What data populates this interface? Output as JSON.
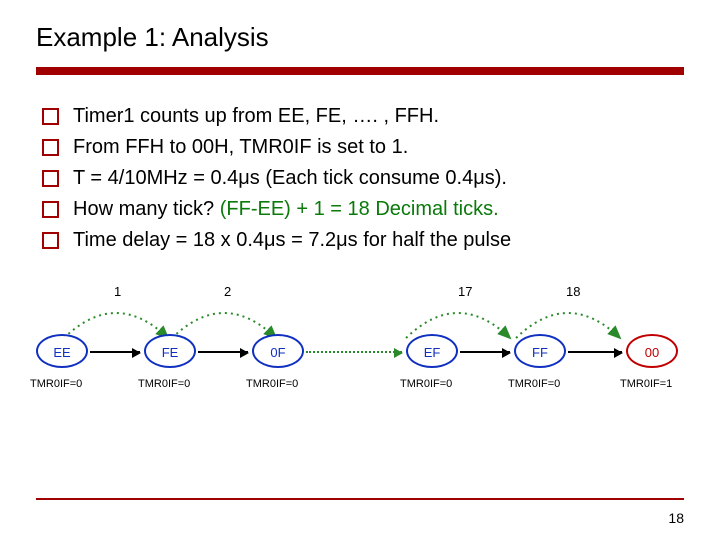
{
  "title": "Example 1: Analysis",
  "bullets": {
    "b0": "Timer1 counts up from EE, FE, …. , FFH.",
    "b1": "From FFH to 00H, TMR0IF is set to 1.",
    "b2": "T = 4/10MHz = 0.4μs (Each tick consume 0.4μs).",
    "b3_pre": "How many tick? ",
    "b3_green": "(FF-EE) + 1 = 18 Decimal ticks.",
    "b4": "Time delay = 18 x 0.4μs = 7.2μs for half the pulse"
  },
  "hops": {
    "h1": "1",
    "h2": "2",
    "h3": "17",
    "h4": "18"
  },
  "nodes": {
    "n0": "EE",
    "n1": "FE",
    "n2": "0F",
    "n3": "EF",
    "n4": "FF",
    "n5": "00"
  },
  "flags": {
    "f0": "TMR0IF=0",
    "f1": "TMR0IF=0",
    "f2": "TMR0IF=0",
    "f3": "TMR0IF=0",
    "f4": "TMR0IF=0",
    "f5": "TMR0IF=1"
  },
  "page": "18"
}
